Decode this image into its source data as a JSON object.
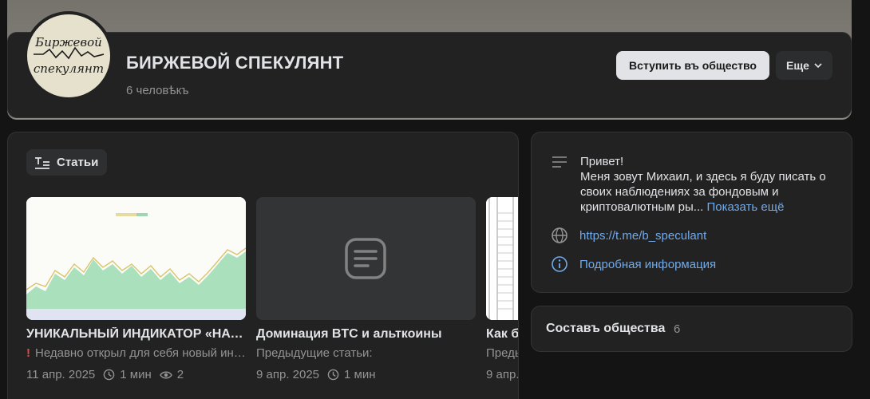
{
  "header": {
    "title": "БИРЖЕВОЙ СПЕКУЛЯНТ",
    "members": "6 человѣкъ",
    "join_label": "Вступить въ общество",
    "more_label": "Еще",
    "avatar_logo_text": [
      "Биржевой",
      "спекулянт"
    ]
  },
  "articles": {
    "tab_label": "Статьи",
    "cards": [
      {
        "title": "УНИКАЛЬНЫЙ ИНДИКАТОР «НАСТРОЕНИЕ РЫНКА»",
        "desc": "Недавно открыл для себя новый индикатор",
        "desc_icon": "exclamation-icon",
        "date": "11 апр. 2025",
        "read_time": "1 мин",
        "views": "2"
      },
      {
        "title": "Доминация BTC и альткоины",
        "desc": "Предыдущие статьи:",
        "date": "9 апр. 2025",
        "read_time": "1 мин"
      },
      {
        "title": "Как б",
        "desc": "Преды",
        "date": "9 апр."
      }
    ]
  },
  "about": {
    "lines": [
      "Привет!",
      "Меня зовут Михаил, и здесь я буду писать о",
      "своих наблюдениях за фондовым и",
      "криптовалютным ры..."
    ],
    "show_more": "Показать ещё",
    "link": "https://t.me/b_speculant",
    "details": "Подробная информация"
  },
  "members_block": {
    "title": "Составъ общества",
    "count": "6"
  },
  "colors": {
    "background": "#141414",
    "panel": "#222222",
    "accent_link": "#71aaeb",
    "muted": "#939393"
  }
}
